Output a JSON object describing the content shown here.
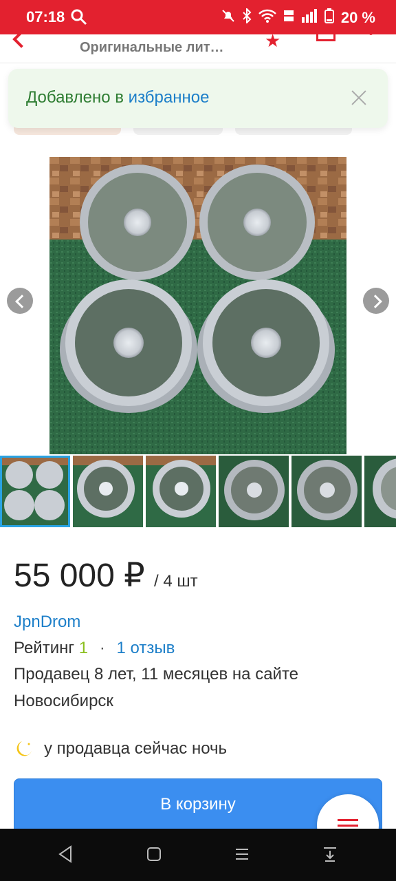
{
  "status_bar": {
    "time": "07:18",
    "battery": "20 %",
    "icons": [
      "search-icon",
      "mute-icon",
      "bluetooth-icon",
      "wifi-icon",
      "volte-icon",
      "signal-icon",
      "battery-icon"
    ]
  },
  "app_bar": {
    "title": "Оригинальные лит…",
    "icons": [
      "back-icon",
      "star-icon",
      "share-icon",
      "more-icon"
    ]
  },
  "toast": {
    "text_prefix": "Добавлено в ",
    "link_text": "избранное"
  },
  "gallery": {
    "thumb_count": 6,
    "active_index": 0
  },
  "listing": {
    "price": "55 000 ₽",
    "price_unit": "/ 4 шт",
    "seller_name": "JpnDrom",
    "rating_label": "Рейтинг",
    "rating_value": "1",
    "rating_sep": "·",
    "reviews": "1 отзыв",
    "seller_since": "Продавец 8 лет, 11 месяцев на сайте",
    "city": "Новосибирск",
    "night_note": "у продавца сейчас ночь"
  },
  "actions": {
    "cart_label": "В корзину"
  },
  "colors": {
    "brand_red": "#e3212f",
    "accent_blue": "#3b8ef0",
    "link_blue": "#1d7fc9",
    "rating_green": "#8bbf1e",
    "toast_green": "#2e7d32"
  }
}
